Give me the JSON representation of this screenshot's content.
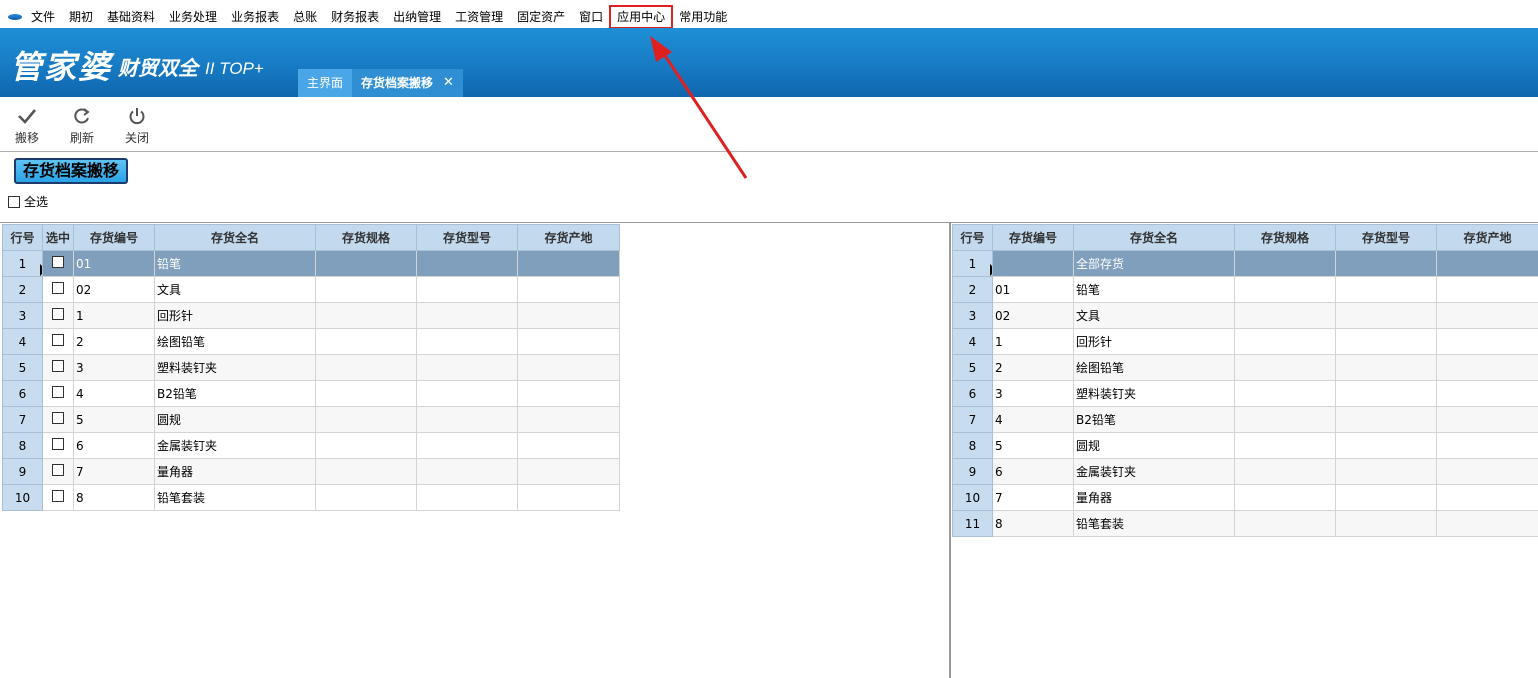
{
  "menubar": {
    "items": [
      "文件",
      "期初",
      "基础资料",
      "业务处理",
      "业务报表",
      "总账",
      "财务报表",
      "出纳管理",
      "工资管理",
      "固定资产",
      "窗口",
      "应用中心",
      "常用功能"
    ]
  },
  "banner": {
    "logo_main": "管家婆",
    "logo_sub": "财贸双全",
    "logo_ver": "II TOP+",
    "tabs": [
      {
        "label": "主界面",
        "active": false
      },
      {
        "label": "存货档案搬移",
        "active": true,
        "close": "✕"
      }
    ]
  },
  "toolbar": {
    "move_label": "搬移",
    "refresh_label": "刷新",
    "close_label": "关闭"
  },
  "page": {
    "heading": "存货档案搬移",
    "select_all_label": "全选"
  },
  "left_grid": {
    "columns": [
      "行号",
      "选中",
      "存货编号",
      "存货全名",
      "存货规格",
      "存货型号",
      "存货产地"
    ],
    "rows": [
      {
        "n": "1",
        "code": "01",
        "name": "铅笔"
      },
      {
        "n": "2",
        "code": "02",
        "name": "文具"
      },
      {
        "n": "3",
        "code": "1",
        "name": "回形针"
      },
      {
        "n": "4",
        "code": "2",
        "name": "绘图铅笔"
      },
      {
        "n": "5",
        "code": "3",
        "name": "塑料装钉夹"
      },
      {
        "n": "6",
        "code": "4",
        "name": "B2铅笔"
      },
      {
        "n": "7",
        "code": "5",
        "name": "圆规"
      },
      {
        "n": "8",
        "code": "6",
        "name": "金属装钉夹"
      },
      {
        "n": "9",
        "code": "7",
        "name": "量角器"
      },
      {
        "n": "10",
        "code": "8",
        "name": "铅笔套装"
      }
    ]
  },
  "right_grid": {
    "columns": [
      "行号",
      "存货编号",
      "存货全名",
      "存货规格",
      "存货型号",
      "存货产地"
    ],
    "rows": [
      {
        "n": "1",
        "code": "",
        "name": "全部存货"
      },
      {
        "n": "2",
        "code": "01",
        "name": "铅笔"
      },
      {
        "n": "3",
        "code": "02",
        "name": "文具"
      },
      {
        "n": "4",
        "code": "1",
        "name": "回形针"
      },
      {
        "n": "5",
        "code": "2",
        "name": "绘图铅笔"
      },
      {
        "n": "6",
        "code": "3",
        "name": "塑料装钉夹"
      },
      {
        "n": "7",
        "code": "4",
        "name": "B2铅笔"
      },
      {
        "n": "8",
        "code": "5",
        "name": "圆规"
      },
      {
        "n": "9",
        "code": "6",
        "name": "金属装钉夹"
      },
      {
        "n": "10",
        "code": "7",
        "name": "量角器"
      },
      {
        "n": "11",
        "code": "8",
        "name": "铅笔套装"
      }
    ]
  },
  "colors": {
    "banner": "#1a82cb",
    "grid_header": "#c2d9ee",
    "selected_row": "#7f9fbc",
    "annotation": "#e02020"
  }
}
